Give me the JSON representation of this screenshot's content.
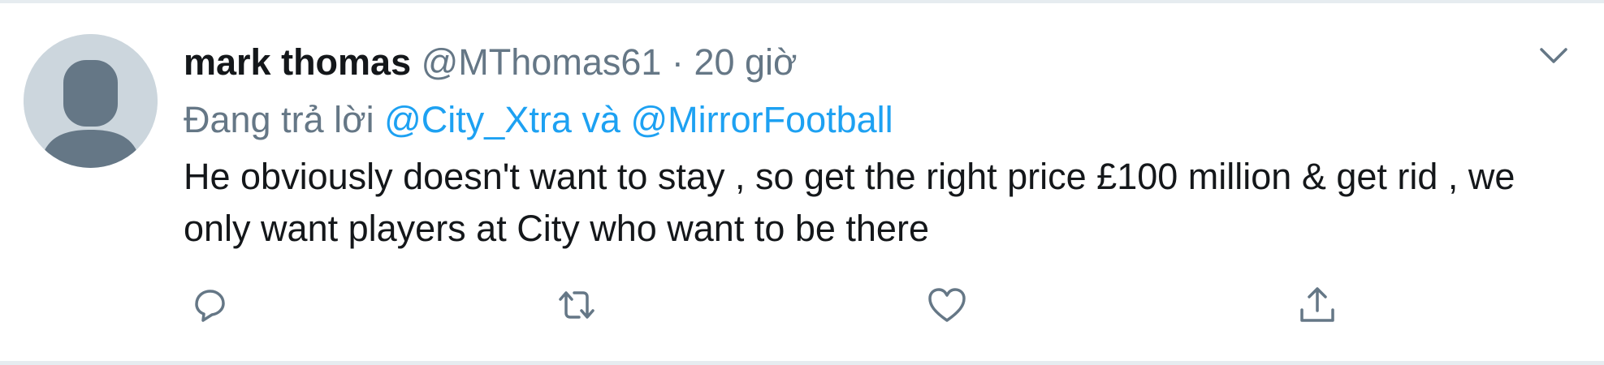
{
  "tweet": {
    "name": "mark thomas",
    "handle": "@MThomas61",
    "separator": "·",
    "time": "20 giờ",
    "reply_prefix": "Đang trả lời",
    "reply_mention_1": "@City_Xtra",
    "reply_connector": "và",
    "reply_mention_2": "@MirrorFootball",
    "text": "He obviously doesn't want to stay , so get the right price £100 million & get rid , we only want players at City who want to be there"
  },
  "actions": [
    "reply-icon",
    "retweet-icon",
    "like-icon",
    "share-icon"
  ],
  "colors": {
    "link": "#1da1f2",
    "secondary_text": "#657786",
    "primary_text": "#14171a",
    "avatar_bg": "#ccd6dd",
    "avatar_fg": "#657786",
    "border": "#e6ecf0"
  }
}
